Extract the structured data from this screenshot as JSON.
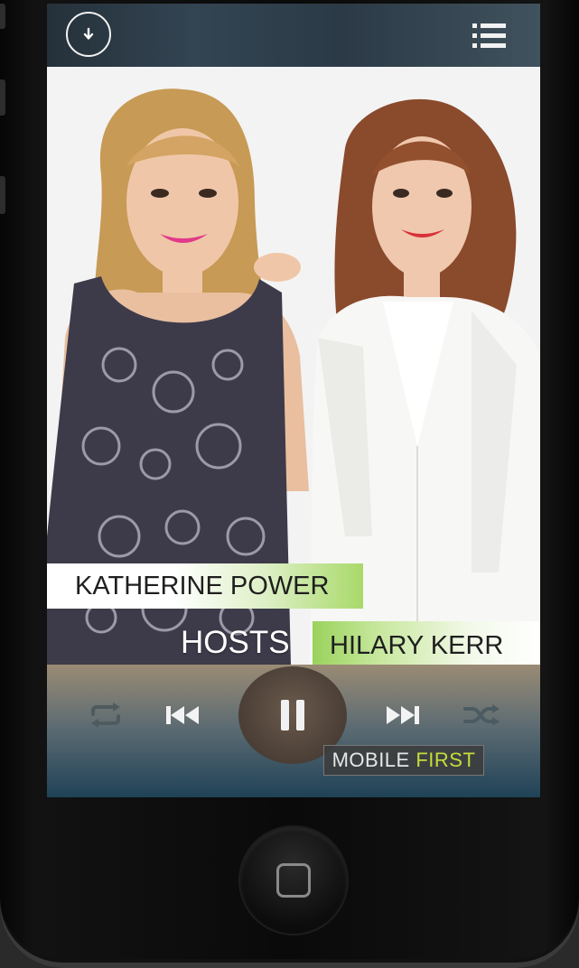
{
  "app": {
    "top_bar": {
      "download_icon": "download-arrow-icon",
      "menu_icon": "playlist-menu-icon"
    },
    "cover": {
      "host_1": "KATHERINE POWER",
      "hosts_label": "HOSTS",
      "host_2": "HILARY KERR"
    },
    "controls": {
      "repeat_icon": "repeat-icon",
      "previous_icon": "previous-track-icon",
      "pause_icon": "pause-icon",
      "next_icon": "next-track-icon",
      "shuffle_icon": "shuffle-icon"
    },
    "brand": {
      "part1": "MOBILE",
      "part2": "FIRST"
    }
  },
  "colors": {
    "accent_green": "#9ad25c",
    "brand_first": "#c6dc3a"
  }
}
